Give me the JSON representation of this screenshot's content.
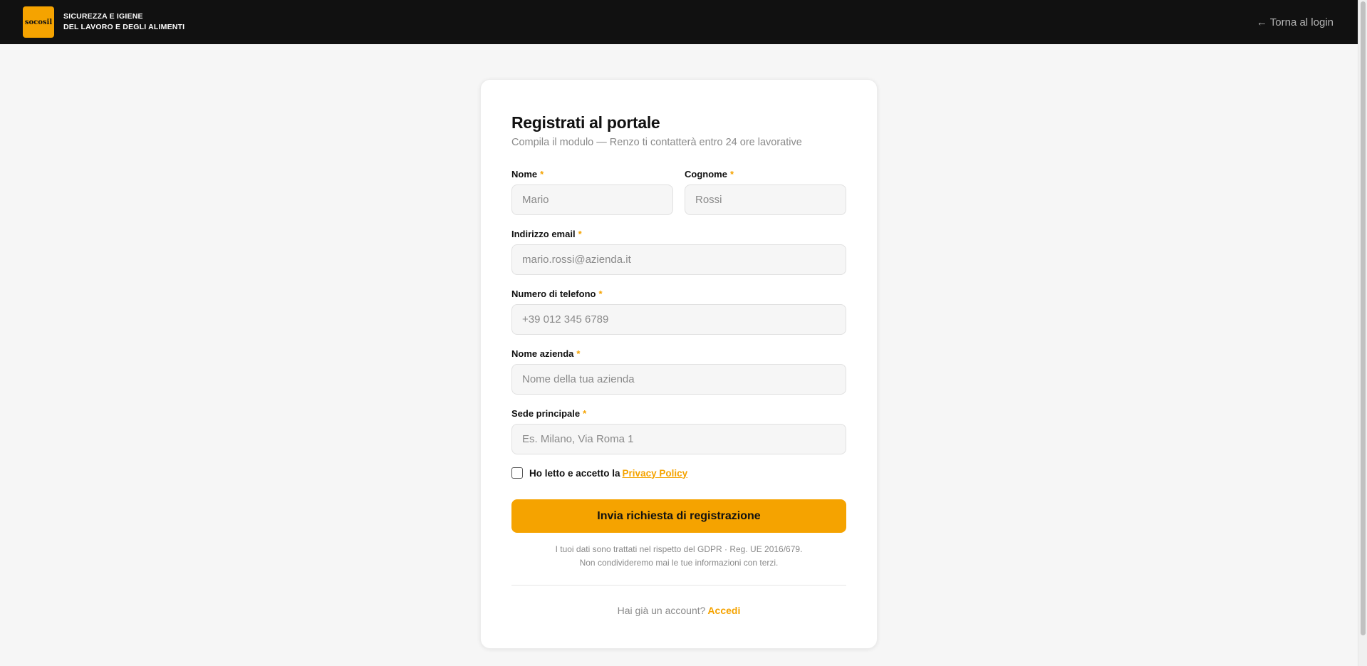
{
  "header": {
    "logo_text": "socosil",
    "brand_line1": "SICUREZZA E IGIENE",
    "brand_line2": "DEL LAVORO E DEGLI ALIMENTI",
    "back_link": "← Torna al login"
  },
  "form": {
    "title": "Registrati al portale",
    "subtitle": "Compila il modulo — Renzo ti contatterà entro 24 ore lavorative",
    "required_marker": "*",
    "fields": {
      "first_name": {
        "label": "Nome",
        "placeholder": "Mario",
        "value": ""
      },
      "last_name": {
        "label": "Cognome",
        "placeholder": "Rossi",
        "value": ""
      },
      "email": {
        "label": "Indirizzo email",
        "placeholder": "mario.rossi@azienda.it",
        "value": ""
      },
      "phone": {
        "label": "Numero di telefono",
        "placeholder": "+39 012 345 6789",
        "value": ""
      },
      "company": {
        "label": "Nome azienda",
        "placeholder": "Nome della tua azienda",
        "value": ""
      },
      "headquarters": {
        "label": "Sede principale",
        "placeholder": "Es. Milano, Via Roma 1",
        "value": ""
      }
    },
    "privacy_checked": false,
    "privacy_text": "Ho letto e accetto la",
    "privacy_link": "Privacy Policy",
    "submit_label": "Invia richiesta di registrazione",
    "gdpr_line1": "I tuoi dati sono trattati nel rispetto del GDPR · Reg. UE 2016/679.",
    "gdpr_line2": "Non condivideremo mai le tue informazioni con terzi.",
    "login_prompt": "Hai già un account?",
    "login_link": "Accedi"
  },
  "colors": {
    "accent": "#f5a300",
    "header_bg": "#111111",
    "page_bg": "#f6f6f6"
  }
}
